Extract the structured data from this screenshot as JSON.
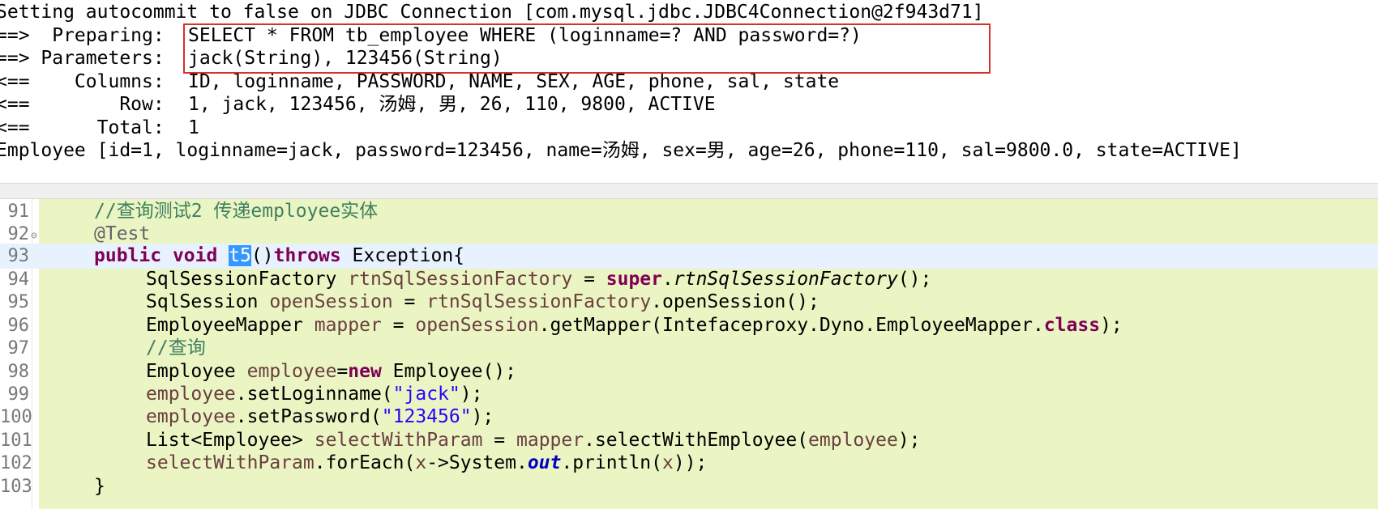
{
  "console": {
    "line1": "Setting autocommit to false on JDBC Connection [com.mysql.jdbc.JDBC4Connection@2f943d71]",
    "preparing_label": "==>  Preparing: ",
    "preparing_value": "SELECT * FROM tb_employee WHERE (loginname=? AND password=?)",
    "parameters_label": "==> Parameters: ",
    "parameters_value": "jack(String), 123456(String)",
    "columns_label": "<==    Columns: ",
    "columns_value": "ID, loginname, PASSWORD, NAME, SEX, AGE, phone, sal, state",
    "row_label": "<==        Row: ",
    "row_value": "1, jack, 123456, 汤姆, 男, 26, 110, 9800, ACTIVE",
    "total_label": "<==      Total: ",
    "total_value": "1",
    "result": "Employee [id=1, loginname=jack, password=123456, name=汤姆, sex=男, age=26, phone=110, sal=9800.0, state=ACTIVE]",
    "highlight_color": "#d9302a"
  },
  "editor": {
    "background": "#ebf5c4",
    "line_numbers": [
      "91",
      "92",
      "93",
      "94",
      "95",
      "96",
      "97",
      "98",
      "99",
      "100",
      "101",
      "102",
      "103"
    ],
    "l91": {
      "comment": "//查询测试2 传递employee实体"
    },
    "l92": {
      "annotation": "@Test"
    },
    "l93": {
      "kw_public": "public",
      "kw_void": "void",
      "method": "t5",
      "paren": "()",
      "kw_throws": "throws",
      "rest": " Exception{"
    },
    "l94": {
      "type": "SqlSessionFactory",
      "var": "rtnSqlSessionFactory",
      "eq": " = ",
      "kw_super": "super",
      "dot": ".",
      "call": "rtnSqlSessionFactory",
      "end": "();"
    },
    "l95": {
      "type": "SqlSession",
      "var": "openSession",
      "eq": " = ",
      "obj": "rtnSqlSessionFactory",
      "rest": ".openSession();"
    },
    "l96": {
      "type": "EmployeeMapper",
      "var": "mapper",
      "eq": " = ",
      "obj": "openSession",
      "rest": ".getMapper(Intefaceproxy.Dyno.EmployeeMapper.",
      "kw_class": "class",
      "end": ");"
    },
    "l97": {
      "comment": "//查询"
    },
    "l98": {
      "type": "Employee",
      "var": "employee",
      "eq": "=",
      "kw_new": "new",
      "rest": " Employee();"
    },
    "l99": {
      "obj": "employee",
      "call": ".setLoginname(",
      "str": "\"jack\"",
      "end": ");"
    },
    "l100": {
      "obj": "employee",
      "call": ".setPassword(",
      "str": "\"123456\"",
      "end": ");"
    },
    "l101": {
      "type": "List<Employee>",
      "var": "selectWithParam",
      "eq": " = ",
      "obj": "mapper",
      "call": ".selectWithEmployee(",
      "arg": "employee",
      "end": ");"
    },
    "l102": {
      "obj": "selectWithParam",
      "call1": ".forEach(",
      "param": "x",
      "arrow": "->System.",
      "field": "out",
      "call2": ".println(",
      "arg": "x",
      "end": "));"
    },
    "l103": {
      "text": "}"
    }
  }
}
